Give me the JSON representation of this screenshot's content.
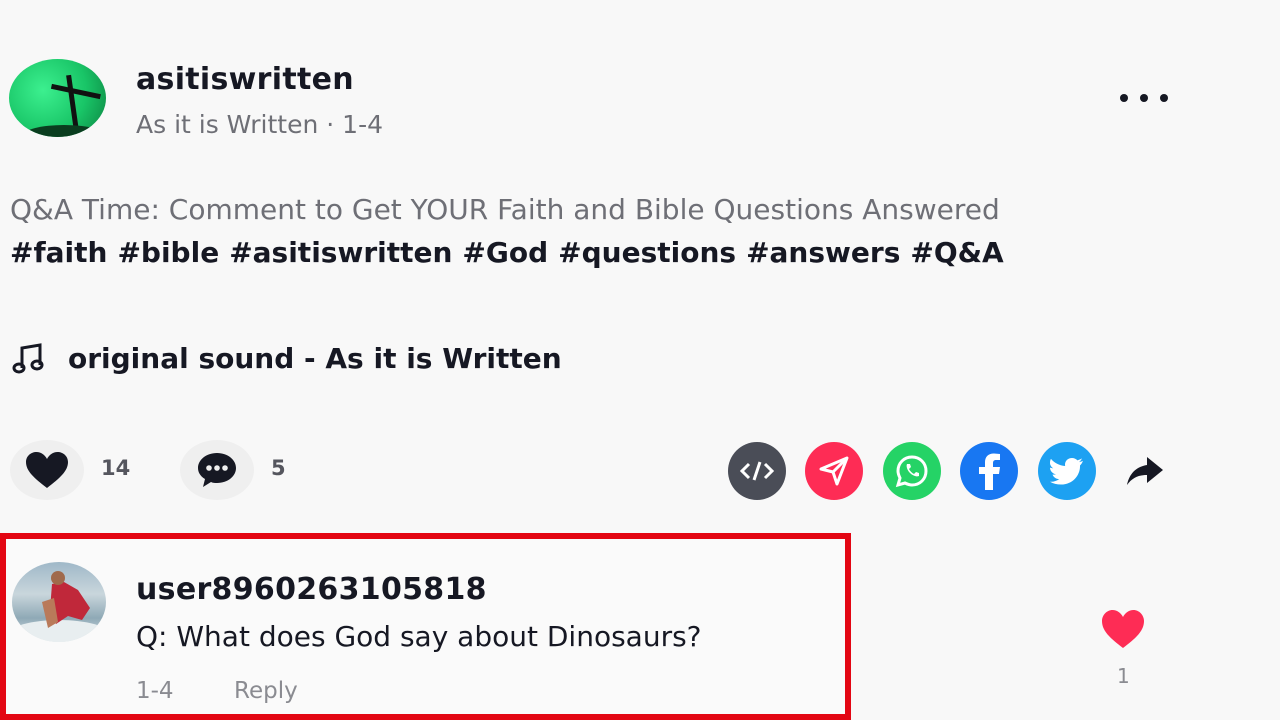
{
  "post": {
    "username": "asitiswritten",
    "subline": "As it is Written · 1-4",
    "caption_text": "Q&A Time: Comment to Get YOUR Faith and Bible Questions Answered ",
    "hashtags": [
      "#faith",
      "#bible",
      "#asitiswritten",
      "#God",
      "#questions",
      "#answers",
      "#Q&A"
    ],
    "sound": "original sound - As it is Written"
  },
  "actions": {
    "like_count": "14",
    "comment_count": "5"
  },
  "colors": {
    "accent": "#fe2c55",
    "highlight_border": "#e30613",
    "whatsapp": "#25d366",
    "facebook": "#1877f2",
    "twitter": "#1da1f2"
  },
  "comment": {
    "username": "user8960263105818",
    "text": "Q: What does God say about Dinosaurs?",
    "date": "1-4",
    "reply_label": "Reply",
    "like_count": "1"
  }
}
